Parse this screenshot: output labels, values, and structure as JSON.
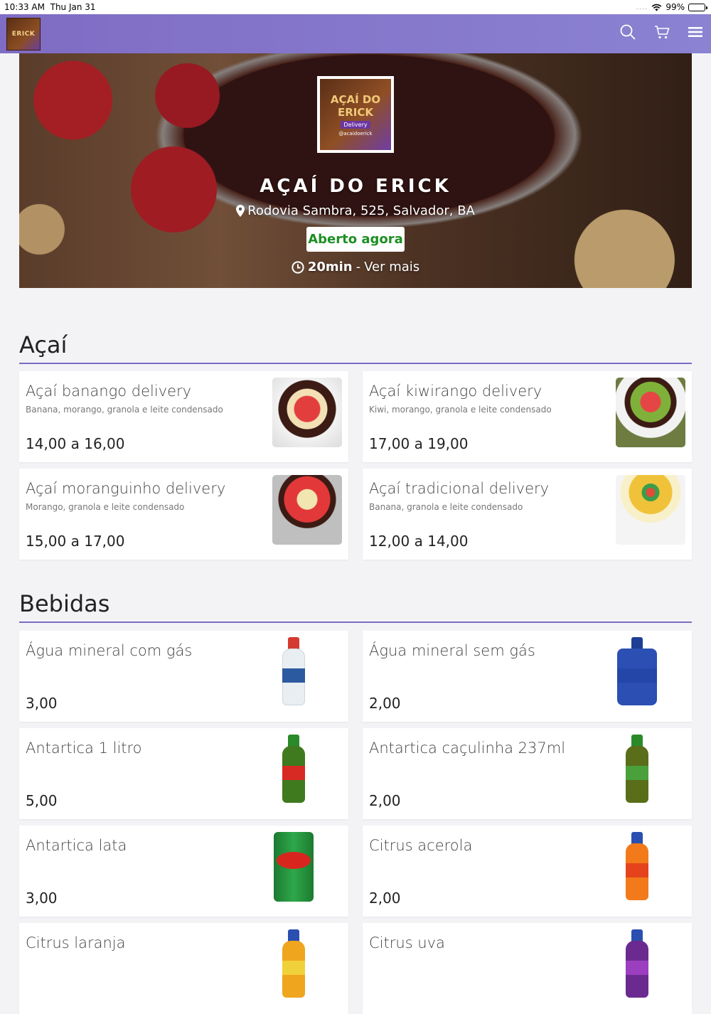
{
  "status_bar": {
    "time": "10:33 AM",
    "date": "Thu Jan 31",
    "battery": "99%",
    "signal_dots": "....",
    "wifi_icon": "wifi-icon"
  },
  "nav": {
    "logo_text": "ERICK",
    "icons": [
      "search-icon",
      "cart-icon",
      "menu-icon"
    ],
    "colors": {
      "bar_start": "#7f6cc4",
      "bar_end": "#8b82d2"
    }
  },
  "store": {
    "logo_title": "AÇAÍ DO ERICK",
    "logo_delivery": "Delivery",
    "logo_handle": "@acaidoerick",
    "name": "AÇAÍ DO ERICK",
    "address": "Rodovia Sambra, 525, Salvador, BA",
    "status": "Aberto agora",
    "delivery_time": "20min",
    "delivery_sep": " - ",
    "more": "Ver mais",
    "status_color": "#1d8f23"
  },
  "sections": [
    {
      "title": "Açaí",
      "items": [
        {
          "name": "Açaí banango delivery",
          "desc": "Banana, morango, granola e leite condensado",
          "price": "14,00 a 16,00"
        },
        {
          "name": "Açaí kiwirango delivery",
          "desc": "Kiwi, morango, granola e leite condensado",
          "price": "17,00 a 19,00"
        },
        {
          "name": "Açaí moranguinho delivery",
          "desc": "Morango, granola e leite condensado",
          "price": "15,00 a 17,00"
        },
        {
          "name": "Açaí tradicional delivery",
          "desc": "Banana, granola e leite condensado",
          "price": "12,00 a 14,00"
        }
      ]
    },
    {
      "title": "Bebidas",
      "items": [
        {
          "name": "Água mineral com gás",
          "desc": "",
          "price": "3,00"
        },
        {
          "name": "Água mineral sem gás",
          "desc": "",
          "price": "2,00"
        },
        {
          "name": "Antartica 1 litro",
          "desc": "",
          "price": "5,00"
        },
        {
          "name": "Antartica caçulinha 237ml",
          "desc": "",
          "price": "2,00"
        },
        {
          "name": "Antartica lata",
          "desc": "",
          "price": "3,00"
        },
        {
          "name": "Citrus acerola",
          "desc": "",
          "price": "2,00"
        },
        {
          "name": "Citrus laranja",
          "desc": "",
          "price": ""
        },
        {
          "name": "Citrus uva",
          "desc": "",
          "price": ""
        }
      ]
    }
  ],
  "accent_color": "#7a6cc2"
}
